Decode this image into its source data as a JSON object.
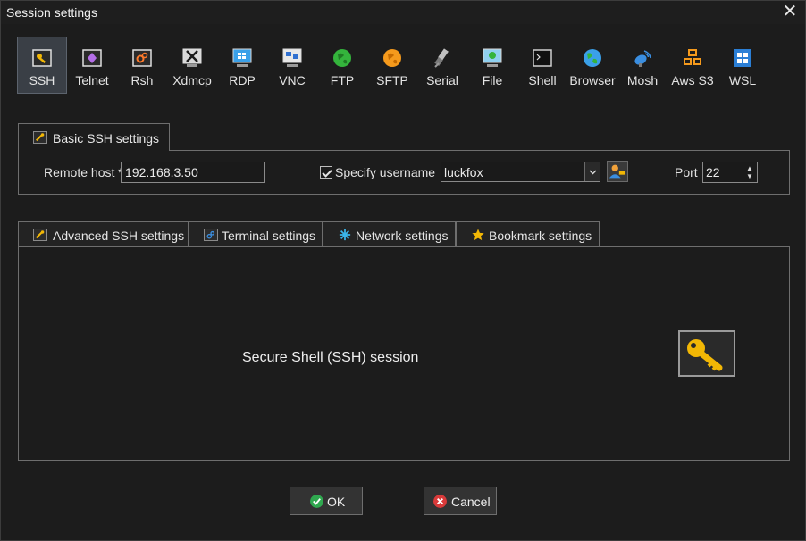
{
  "window": {
    "title": "Session settings",
    "close_glyph": "✕"
  },
  "session_types": [
    {
      "label": "SSH",
      "icon": "ssh-icon",
      "active": true
    },
    {
      "label": "Telnet",
      "icon": "telnet-icon",
      "active": false
    },
    {
      "label": "Rsh",
      "icon": "rsh-icon",
      "active": false
    },
    {
      "label": "Xdmcp",
      "icon": "xdmcp-icon",
      "active": false
    },
    {
      "label": "RDP",
      "icon": "rdp-icon",
      "active": false
    },
    {
      "label": "VNC",
      "icon": "vnc-icon",
      "active": false
    },
    {
      "label": "FTP",
      "icon": "ftp-icon",
      "active": false
    },
    {
      "label": "SFTP",
      "icon": "sftp-icon",
      "active": false
    },
    {
      "label": "Serial",
      "icon": "serial-icon",
      "active": false
    },
    {
      "label": "File",
      "icon": "file-icon",
      "active": false
    },
    {
      "label": "Shell",
      "icon": "shell-icon",
      "active": false
    },
    {
      "label": "Browser",
      "icon": "browser-icon",
      "active": false
    },
    {
      "label": "Mosh",
      "icon": "mosh-icon",
      "active": false
    },
    {
      "label": "Aws S3",
      "icon": "aws-s3-icon",
      "active": false
    },
    {
      "label": "WSL",
      "icon": "wsl-icon",
      "active": false
    }
  ],
  "basic": {
    "tab_label": "Basic SSH settings",
    "remote_host_label": "Remote host *",
    "remote_host_value": "192.168.3.50",
    "specify_username_label": "Specify username",
    "specify_username_checked": true,
    "username_value": "luckfox",
    "port_label": "Port",
    "port_value": "22"
  },
  "subtabs": [
    {
      "label": "Advanced SSH settings",
      "icon": "wrench-icon"
    },
    {
      "label": "Terminal settings",
      "icon": "terminal-icon"
    },
    {
      "label": "Network settings",
      "icon": "network-icon"
    },
    {
      "label": "Bookmark settings",
      "icon": "star-icon"
    }
  ],
  "panel": {
    "text": "Secure Shell (SSH) session"
  },
  "buttons": {
    "ok": "OK",
    "cancel": "Cancel"
  },
  "colors": {
    "ok_green": "#2fa84f",
    "cancel_red": "#d93a3a",
    "key_gold": "#f2b705",
    "background": "#1c1c1c"
  }
}
